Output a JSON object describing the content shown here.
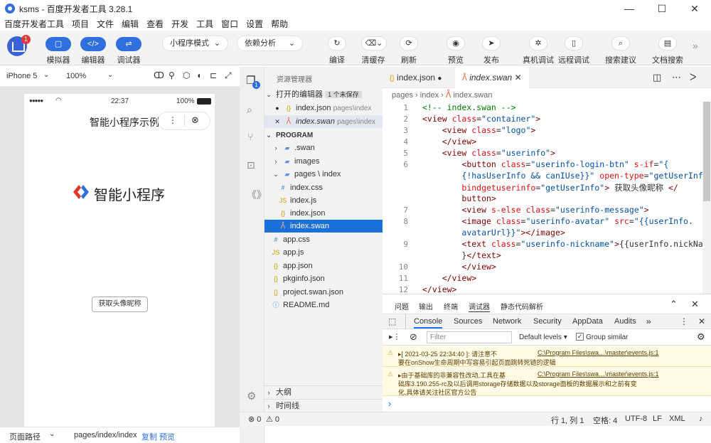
{
  "window": {
    "title": "ksms - 百度开发者工具 3.28.1",
    "minimize": "—",
    "maximize": "☐",
    "close": "✕"
  },
  "menu": [
    "百度开发者工具",
    "项目",
    "文件",
    "编辑",
    "查看",
    "开发",
    "工具",
    "窗口",
    "设置",
    "帮助"
  ],
  "toolbar": {
    "notification_count": "1",
    "simulator": "模拟器",
    "editor": "编辑器",
    "debugger": "调试器",
    "mode": "小程序模式",
    "deps": "依赖分析",
    "compile": "编译",
    "clear_cache": "清缓存",
    "refresh": "刷新",
    "preview": "预览",
    "publish": "发布",
    "remote_real": "真机调试",
    "remote_debug": "远程调试",
    "search_suggest": "搜索建议",
    "doc_search": "文档搜索",
    "more": "»"
  },
  "simulator": {
    "device": "iPhone 5",
    "zoom": "100%",
    "status_signal": "●●●●●",
    "status_time": "22:37",
    "status_battery": "100%",
    "nav_title": "智能小程序示例",
    "logo_text": "智能小程序",
    "button": "获取头像昵称",
    "footer_label": "页面路径",
    "footer_path": "pages/index/index",
    "footer_copy": "复制",
    "footer_preview": "预览"
  },
  "explorer": {
    "header": "资源管理器",
    "open_editors": "打开的编辑器",
    "unsaved": "1 个未保存",
    "open1_name": "index.json",
    "open1_path": "pages\\index",
    "open2_name": "index.swan",
    "open2_path": "pages\\index",
    "project": "PROGRAM",
    "items": [
      ".swan",
      "images",
      "pages \\ index",
      "index.css",
      "index.js",
      "index.json",
      "index.swan",
      "app.css",
      "app.js",
      "app.json",
      "pkginfo.json",
      "project.swan.json",
      "README.md"
    ],
    "outline": "大纲",
    "timeline": "时间线"
  },
  "editor": {
    "tab1": "index.json",
    "tab2": "index.swan",
    "breadcrumb1": "pages",
    "breadcrumb2": "index",
    "breadcrumb3": "index.swan"
  },
  "panel": {
    "tabs": [
      "问题",
      "输出",
      "终端",
      "调试器",
      "静态代码解析"
    ],
    "devtabs": [
      "Console",
      "Sources",
      "Network",
      "Security",
      "AppData",
      "Audits",
      "»"
    ],
    "filter": "Filter",
    "levels": "Default levels ▾",
    "group": "Group similar",
    "msg1a": "▸[ 2021-03-25 22:34:40 ]: 请注意不",
    "msg1b": "要在onShow生命周期中写容易引起页面跳转死链的逻辑",
    "msg1link": "C:\\Program Files\\swa…\\master\\events.js:1",
    "msg2a": "▸由于基础库的非兼容性改动,工具在基",
    "msg2b": "础库3.190.255-rc及以后调用storage存储数据以及storage面板的数据展示和之前有变",
    "msg2c": "化,具体请关注社区官方公告",
    "msg2link": "C:\\Program Files\\swa…\\master\\events.js:1",
    "prompt": "›"
  },
  "status": {
    "errors": "⊗ 0",
    "warnings": "⚠ 0",
    "pos": "行 1, 列 1",
    "spaces": "空格: 4",
    "enc": "UTF-8",
    "eol": "LF",
    "lang": "XML"
  }
}
